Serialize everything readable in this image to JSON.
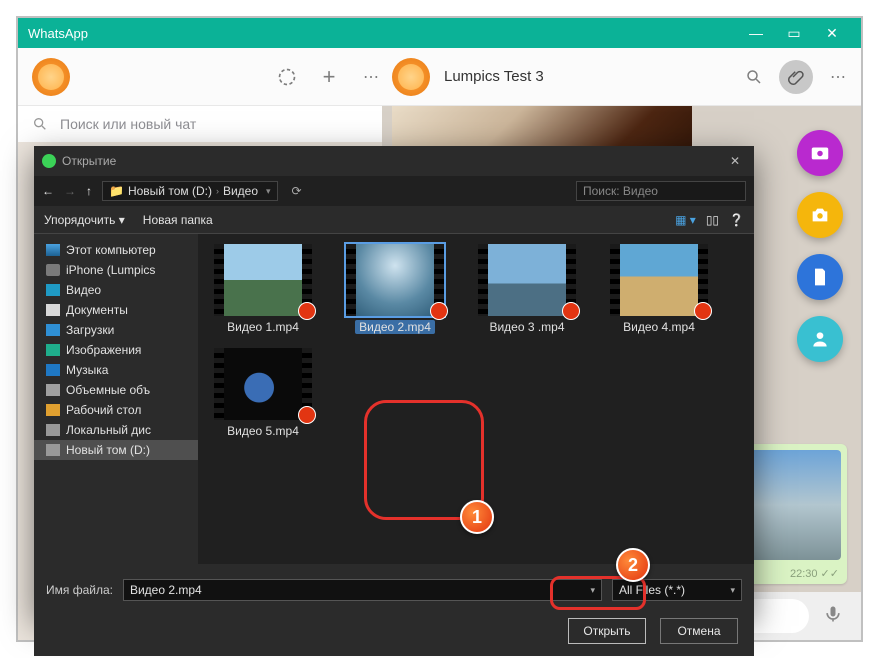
{
  "window": {
    "title": "WhatsApp"
  },
  "header": {
    "chat_name": "Lumpics Test 3"
  },
  "sidebar": {
    "search_placeholder": "Поиск или новый чат"
  },
  "chat": {
    "msg_time": "22:30 ✓✓"
  },
  "attach": {
    "photo": "photo",
    "camera": "camera",
    "document": "document",
    "contact": "contact"
  },
  "dialog": {
    "title": "Открытие",
    "path_root": "Новый том (D:)",
    "path_leaf": "Видео",
    "search_placeholder": "Поиск: Видео",
    "organize": "Упорядочить",
    "new_folder": "Новая папка",
    "tree": [
      {
        "label": "Этот компьютер",
        "icon": "ic-pc"
      },
      {
        "label": "iPhone (Lumpics",
        "icon": "ic-ph"
      },
      {
        "label": "Видео",
        "icon": "ic-vid"
      },
      {
        "label": "Документы",
        "icon": "ic-doc"
      },
      {
        "label": "Загрузки",
        "icon": "ic-dl"
      },
      {
        "label": "Изображения",
        "icon": "ic-img"
      },
      {
        "label": "Музыка",
        "icon": "ic-mus"
      },
      {
        "label": "Объемные объ",
        "icon": "ic-vol"
      },
      {
        "label": "Рабочий стол",
        "icon": "ic-desk"
      },
      {
        "label": "Локальный дис",
        "icon": "ic-disk"
      },
      {
        "label": "Новый том (D:)",
        "icon": "ic-disk",
        "selected": true
      }
    ],
    "files": [
      {
        "name": "Видео 1.mp4",
        "thumb": "v1"
      },
      {
        "name": "Видео 2.mp4",
        "thumb": "v2",
        "selected": true
      },
      {
        "name": "Видео 3 .mp4",
        "thumb": "v3"
      },
      {
        "name": "Видео 4.mp4",
        "thumb": "v4"
      },
      {
        "name": "Видео 5.mp4",
        "thumb": "v5"
      }
    ],
    "filename_label": "Имя файла:",
    "filename_value": "Видео 2.mp4",
    "filter": "All Files (*.*)",
    "open": "Открыть",
    "cancel": "Отмена"
  },
  "callouts": {
    "one": "1",
    "two": "2"
  }
}
